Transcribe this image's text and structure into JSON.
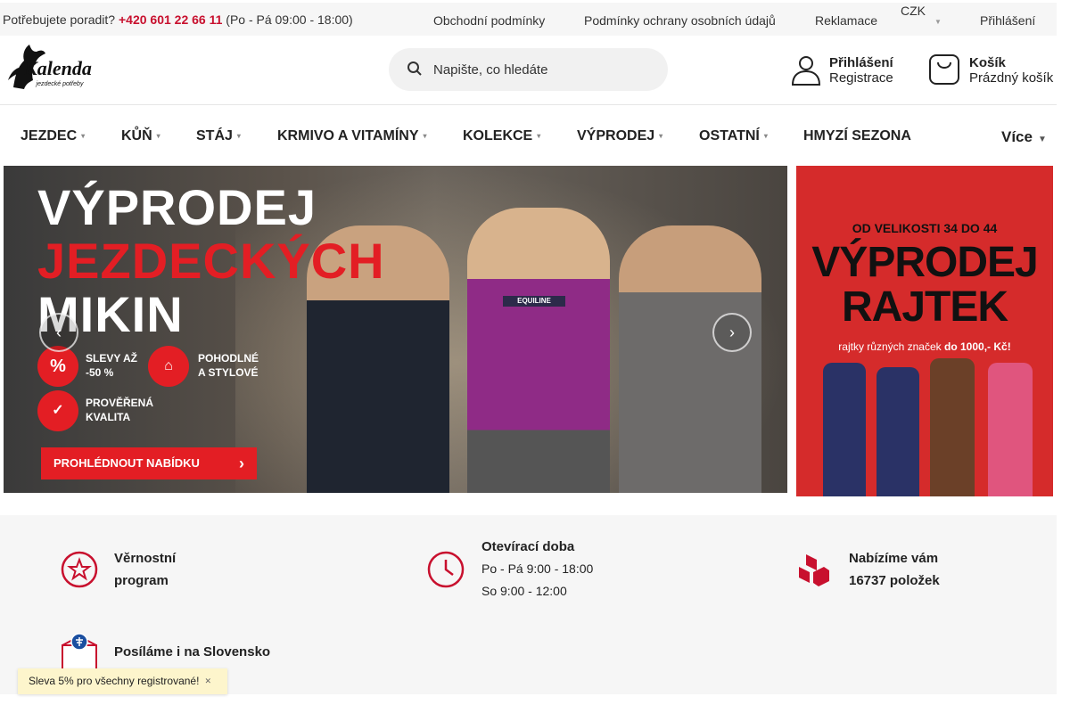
{
  "topbar": {
    "help_prefix": "Potřebujete poradit?",
    "phone": "+420 601 22 66 11",
    "hours": "(Po - Pá 09:00 - 18:00)",
    "links": [
      "Obchodní podmínky",
      "Podmínky ochrany osobních údajů",
      "Reklamace"
    ],
    "currency": "CZK",
    "login": "Přihlášení"
  },
  "header": {
    "logo_text": "Kalenda",
    "logo_sub": "jezdecké potřeby",
    "search_placeholder": "Napište, co hledáte",
    "account_title": "Přihlášení",
    "account_sub": "Registrace",
    "cart_title": "Košík",
    "cart_sub": "Prázdný košík"
  },
  "nav": {
    "items": [
      "JEZDEC",
      "KŮŇ",
      "STÁJ",
      "KRMIVO A VITAMÍNY",
      "KOLEKCE",
      "VÝPRODEJ",
      "OSTATNÍ",
      "HMYZÍ SEZONA"
    ],
    "more": "Více"
  },
  "banner_main": {
    "line1": "VÝPRODEJ",
    "line2": "JEZDECKÝCH",
    "line3": "MIKIN",
    "feature1": "SLEVY AŽ\n-50 %",
    "feature2": "POHODLNÉ\nA STYLOVÉ",
    "feature3": "PROVĚŘENÁ\nKVALITA",
    "cta": "PROHLÉDNOUT NABÍDKU",
    "sweater_brand": "EQUILINE"
  },
  "banner_side": {
    "size_text": "OD VELIKOSTI 34 DO 44",
    "line1": "VÝPRODEJ",
    "line2": "RAJTEK",
    "sub_a": "rajtky různých značek ",
    "sub_b": "do 1000,- Kč!"
  },
  "info": {
    "loyalty_1": "Věrnostní",
    "loyalty_2": "program",
    "hours_title": "Otevírací doba",
    "hours_1": "Po - Pá 9:00 - 18:00",
    "hours_2": "So 9:00 - 12:00",
    "offer_1": "Nabízíme vám",
    "offer_2": "16737 položek",
    "slovakia": "Posíláme i na Slovensko"
  },
  "promo": {
    "text": "Sleva 5% pro všechny registrované!"
  },
  "colors": {
    "accent_red": "#c8102e",
    "banner_red": "#e31e24",
    "info_bg": "#f6f6f6"
  }
}
